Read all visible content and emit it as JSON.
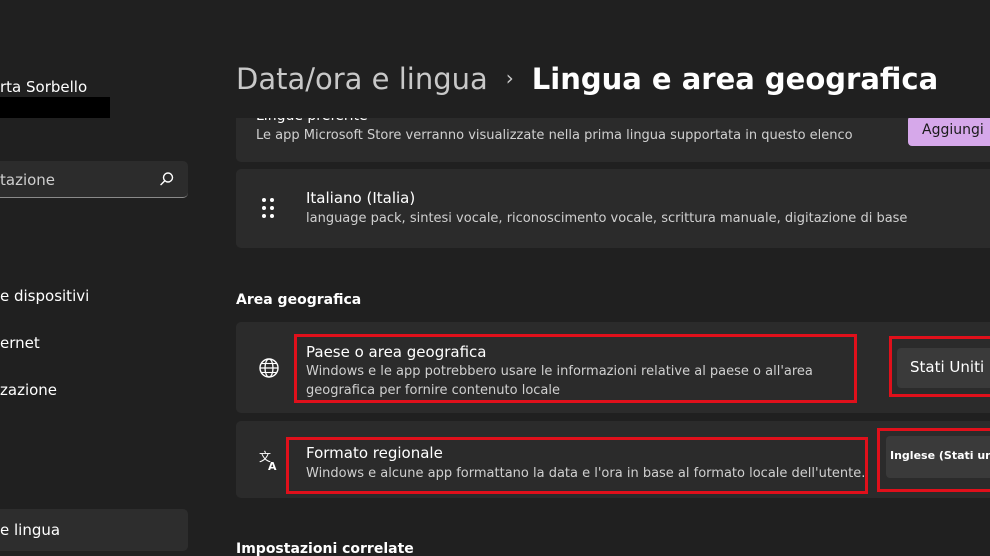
{
  "sidebar": {
    "user_name": "rta Sorbello",
    "search_placeholder": "tazione",
    "items": [
      {
        "label": "e dispositivi"
      },
      {
        "label": "ernet"
      },
      {
        "label": "zazione"
      },
      {
        "label": "e lingua"
      }
    ]
  },
  "header": {
    "parent": "Data/ora e lingua",
    "separator": "›",
    "current": "Lingua e area geografica"
  },
  "preferred_languages": {
    "title": "Lingue preferite",
    "description": "Le app Microsoft Store verranno visualizzate nella prima lingua supportata in questo elenco",
    "add_button": "Aggiungi"
  },
  "language_item": {
    "name": "Italiano (Italia)",
    "features": "language pack, sintesi vocale, riconoscimento vocale, scrittura manuale, digitazione di base"
  },
  "region_section": {
    "heading": "Area geografica",
    "country": {
      "title": "Paese o area geografica",
      "description_line1": "Windows e le app potrebbero usare le informazioni relative al paese o all'area",
      "description_line2": "geografica per fornire contenuto locale",
      "value": "Stati Uniti"
    },
    "format": {
      "title": "Formato regionale",
      "description": "Windows e alcune app formattano la data e l'ora in base al formato locale dell'utente.",
      "value": "Inglese (Stati uniti"
    }
  },
  "related_section": {
    "heading": "Impostazioni correlate"
  },
  "colors": {
    "background": "#202020",
    "card": "#2b2b2b",
    "accent_button": "#d6a8ea",
    "highlight": "#e0101b"
  }
}
